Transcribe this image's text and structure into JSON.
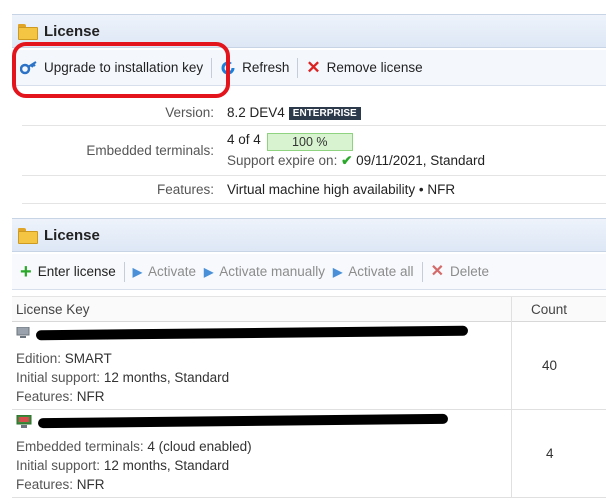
{
  "panel1": {
    "title": "License",
    "toolbar": {
      "upgrade_label": "Upgrade to installation key",
      "refresh_label": "Refresh",
      "remove_label": "Remove license"
    },
    "version_label": "Version:",
    "version_value": "8.2 DEV4",
    "version_badge": "ENTERPRISE",
    "terminals_label": "Embedded terminals:",
    "terminals_count": "4 of 4",
    "terminals_progress": 100,
    "terminals_progress_text": "100 %",
    "support_prefix": "Support expire on:",
    "support_value": "09/11/2021, Standard",
    "features_label": "Features:",
    "features_value": "Virtual machine high availability • NFR"
  },
  "panel2": {
    "title": "License",
    "toolbar": {
      "enter_label": "Enter license",
      "activate_label": "Activate",
      "activate_manual_label": "Activate manually",
      "activate_all_label": "Activate all",
      "delete_label": "Delete"
    },
    "columns": [
      "License Key",
      "Count"
    ],
    "rows": [
      {
        "edition_label": "Edition:",
        "edition_value": "SMART",
        "support_label": "Initial support:",
        "support_value": "12 months, Standard",
        "features_label": "Features:",
        "features_value": "NFR",
        "count": "40"
      },
      {
        "terminals_label": "Embedded terminals:",
        "terminals_value": "4 (cloud enabled)",
        "support_label": "Initial support:",
        "support_value": "12 months, Standard",
        "features_label": "Features:",
        "features_value": "NFR",
        "count": "4"
      }
    ]
  },
  "colors": {
    "accent": "#1a73c9",
    "annotation": "#e3141c",
    "badge_bg": "#2d3a4b",
    "progress_fill": "#d7f3cf"
  },
  "icons": [
    "folder-icon",
    "upgrade-key-icon",
    "refresh-icon",
    "remove-x-icon",
    "add-plus-icon",
    "activate-arrow-icon",
    "delete-x-icon",
    "check-icon",
    "terminal-icon"
  ]
}
